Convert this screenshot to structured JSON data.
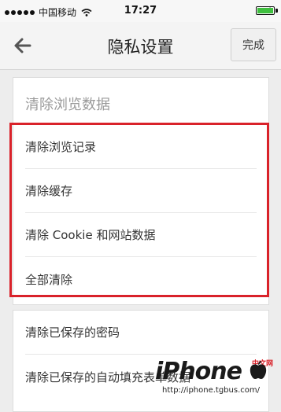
{
  "status_bar": {
    "carrier": "中国移动",
    "time": "17:27"
  },
  "nav": {
    "title": "隐私设置",
    "done_label": "完成",
    "back_icon": "arrow-left-icon"
  },
  "clear_browsing": {
    "header": "清除浏览数据",
    "items": [
      {
        "label": "清除浏览记录"
      },
      {
        "label": "清除缓存"
      },
      {
        "label": "清除 Cookie 和网站数据"
      },
      {
        "label": "全部清除"
      }
    ]
  },
  "saved_data": {
    "items": [
      {
        "label": "清除已保存的密码"
      },
      {
        "label": "清除已保存的自动填充表单数据"
      }
    ]
  },
  "watermark": {
    "brand": "iPhone",
    "site_cn": "中文网",
    "url": "http://iphone.tgbus.com/"
  },
  "colors": {
    "highlight": "#d9222a",
    "battery": "#3fbf3f",
    "header_text": "#9a9a9a"
  }
}
